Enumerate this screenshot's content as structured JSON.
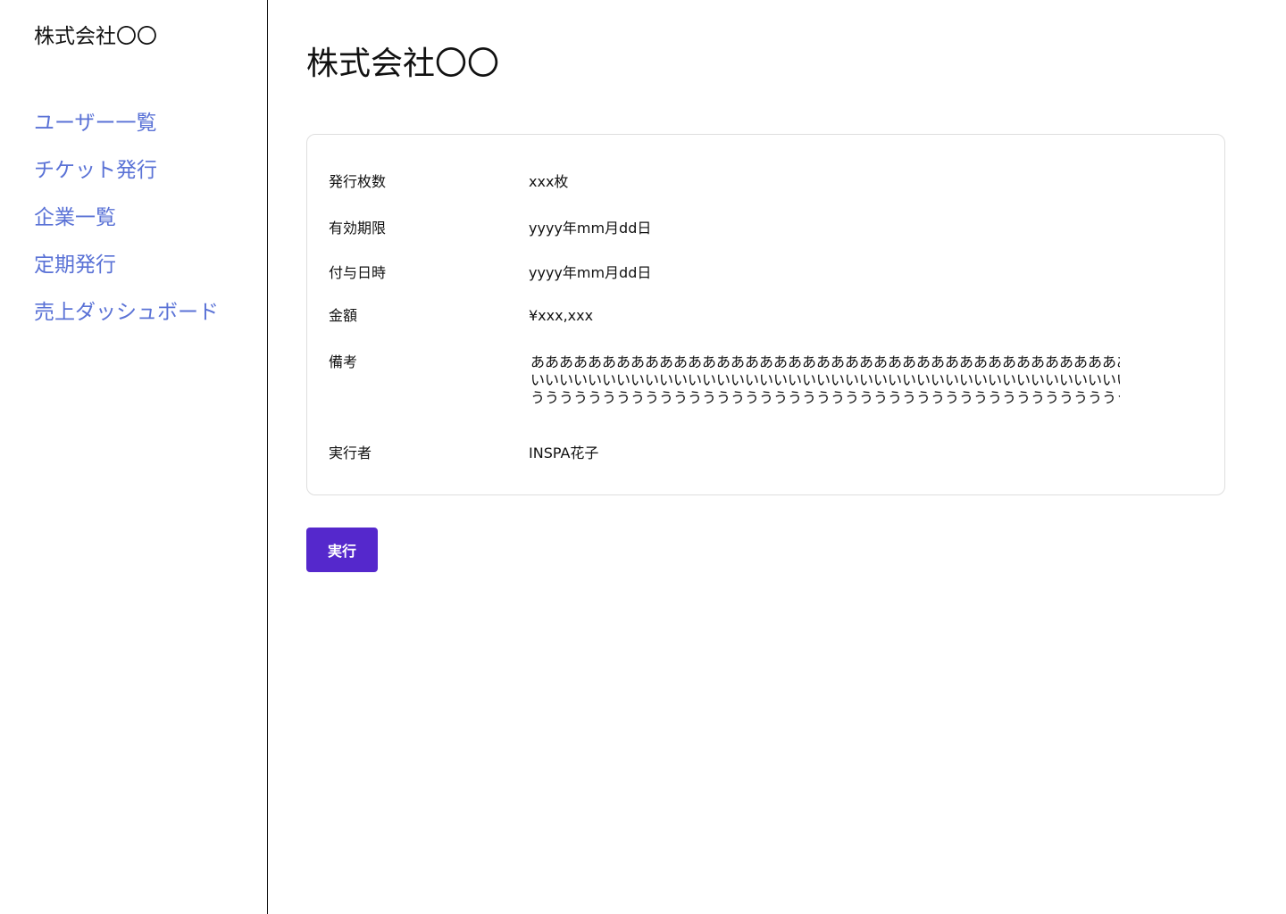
{
  "sidebar": {
    "brand": "株式会社〇〇",
    "nav": [
      {
        "label": "ユーザー一覧"
      },
      {
        "label": "チケット発行"
      },
      {
        "label": "企業一覧"
      },
      {
        "label": "定期発行"
      },
      {
        "label": "売上ダッシュボード"
      }
    ]
  },
  "main": {
    "title": "株式会社〇〇",
    "details": {
      "issue_count": {
        "label": "発行枚数",
        "value": "xxx枚"
      },
      "expiry": {
        "label": "有効期限",
        "value": "yyyy年mm月dd日"
      },
      "grant_date": {
        "label": "付与日時",
        "value": "yyyy年mm月dd日"
      },
      "amount": {
        "label": "金額",
        "value": "¥xxx,xxx"
      },
      "notes": {
        "label": "備考",
        "lines": [
          "ああああああああああああああああああああああああああああああああああああああああああ",
          "いいいいいいいいいいいいいいいいいいいいいいいいいいいいいいいいいいいいいいいいいい",
          "うううううううううううううううううううううううううううううううううううううううううう"
        ]
      },
      "executor": {
        "label": "実行者",
        "value": "INSPA花子"
      }
    },
    "execute_label": "実行"
  },
  "colors": {
    "nav_link": "#5a72d6",
    "primary_button": "#5528cc",
    "card_border": "#dedede"
  }
}
